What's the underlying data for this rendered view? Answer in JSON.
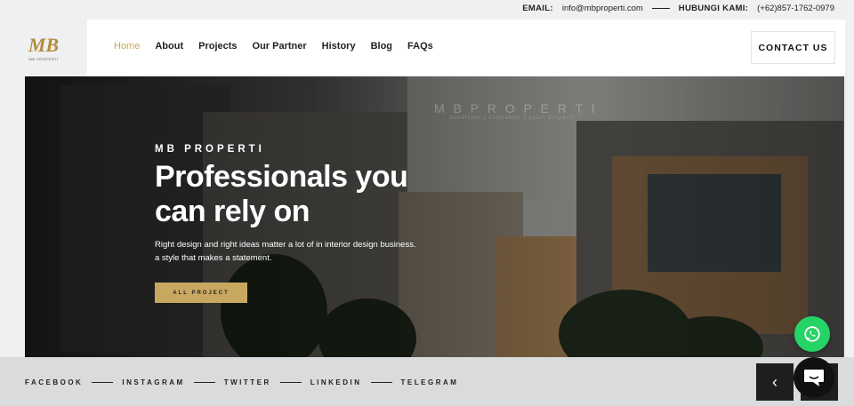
{
  "topbar": {
    "email_label": "EMAIL:",
    "email_value": "info@mbproperti.com",
    "phone_label": "HUBUNGI KAMI:",
    "phone_value": "(+62)857-1762-0979"
  },
  "logo": {
    "mark": "MB",
    "tagline": "MB PROPERTI"
  },
  "nav": {
    "items": [
      {
        "label": "Home",
        "active": true
      },
      {
        "label": "About"
      },
      {
        "label": "Projects"
      },
      {
        "label": "Our Partner"
      },
      {
        "label": "History"
      },
      {
        "label": "Blog"
      },
      {
        "label": "FAQs"
      }
    ],
    "contact_label": "CONTACT US"
  },
  "hero": {
    "watermark": "M B P R O P E R T I",
    "watermark_sub": "developer | kontraktor | agent properti",
    "eyebrow": "MB PROPERTI",
    "headline": "Professionals you can rely on",
    "description": "Right design and right ideas matter a lot of in interior design business. a style that makes a statement.",
    "cta_label": "ALL PROJECT"
  },
  "social": {
    "items": [
      "FACEBOOK",
      "INSTAGRAM",
      "TWITTER",
      "LINKEDIN",
      "TELEGRAM"
    ]
  },
  "slider": {
    "prev_icon": "chevron-left-icon",
    "next_icon": "chevron-right-icon"
  },
  "widgets": {
    "whatsapp_icon": "whatsapp-icon",
    "chat_icon": "chat-bubble-icon"
  },
  "colors": {
    "accent": "#c8a860",
    "dark": "#1e1e1e",
    "whatsapp": "#25d366"
  }
}
